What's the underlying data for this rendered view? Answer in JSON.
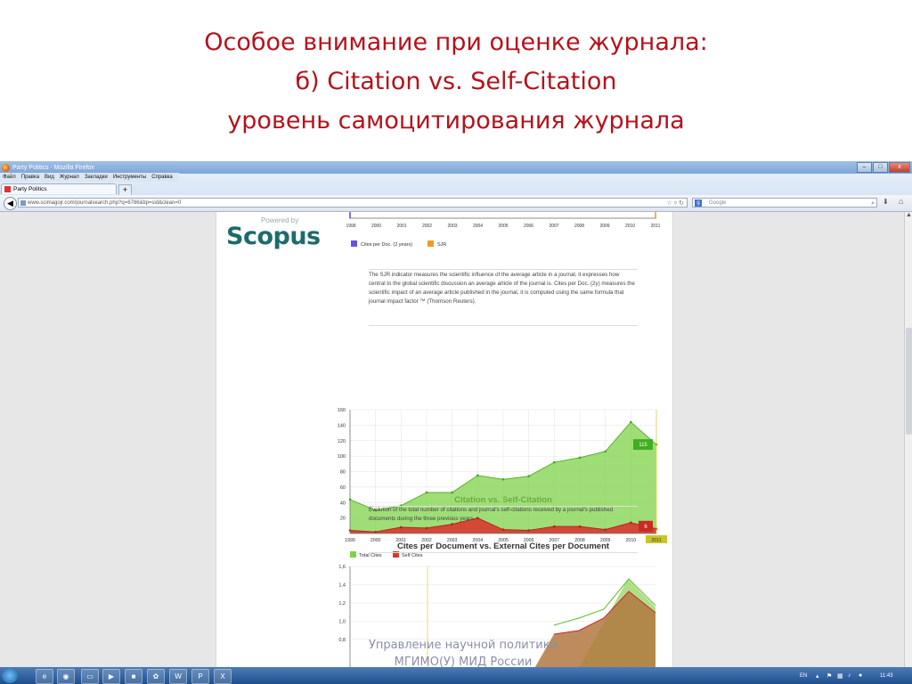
{
  "slide": {
    "title_line1": "Особое внимание при оценке журнала:",
    "title_line2": "б) Citation vs. Self-Citation",
    "title_line3": "уровень самоцитирования журнала",
    "watermark_line1": "Управление научной политики",
    "watermark_line2": "МГИМО(У) МИД России"
  },
  "browser": {
    "window_title": "Party Politics - Mozilla Firefox",
    "menu": [
      "Файл",
      "Правка",
      "Вид",
      "Журнал",
      "Закладки",
      "Инструменты",
      "Справка"
    ],
    "tab_label": "Party Politics",
    "new_tab_label": "+",
    "url": "www.scimagojr.com/journalsearch.php?q=6786&tip=sid&clean=0",
    "url_domain": "scimagojr.com",
    "search_placeholder": "Google",
    "window_controls": [
      "–",
      "□",
      "x"
    ]
  },
  "page": {
    "powered_by": "Powered by",
    "scopus": "Scopus",
    "top_legend": [
      "Cites per Doc. (2 years)",
      "SJR"
    ],
    "top_years": [
      "1999",
      "2000",
      "2001",
      "2002",
      "2003",
      "2004",
      "2005",
      "2006",
      "2007",
      "2008",
      "2009",
      "2010",
      "2011"
    ],
    "description": "The SJR indicator measures the scientific influence of the average article in a journal, it expresses how central to the global scientific discussion an average article of the journal is. Cites per Doc. (2y) measures the scientific impact of an average article published in the journal, it is computed using the same formula that journal impact factor ™ (Thomson Reuters).",
    "chart1_title": "Citation vs. Self-Citation",
    "chart1_description": "Evolution of the total number of citations and journal's self-citations received by a journal's published documents during the three previous years.",
    "chart2_title": "Cites per Document vs. External Cites per Document"
  },
  "chart_data": [
    {
      "type": "area",
      "title": "Citation vs. Self-Citation",
      "x": [
        "1999",
        "2000",
        "2001",
        "2002",
        "2003",
        "2004",
        "2005",
        "2006",
        "2007",
        "2008",
        "2009",
        "2010",
        "2011"
      ],
      "ylim": [
        0,
        160
      ],
      "yticks": [
        20,
        40,
        60,
        80,
        100,
        120,
        140,
        160
      ],
      "series": [
        {
          "name": "Total Cites",
          "color": "#7fd34a",
          "values": [
            44,
            30,
            36,
            53,
            53,
            75,
            70,
            74,
            92,
            98,
            106,
            144,
            115
          ]
        },
        {
          "name": "Self Cites",
          "color": "#d8382f",
          "values": [
            4,
            2,
            8,
            7,
            12,
            20,
            5,
            4,
            9,
            9,
            5,
            14,
            6
          ]
        }
      ],
      "end_labels": [
        "115",
        "6"
      ],
      "highlight_x": "2011"
    },
    {
      "type": "area",
      "title": "Cites per Document vs. External Cites per Document",
      "ylim": [
        0.6,
        1.6
      ],
      "yticks": [
        "0,8",
        "1,0",
        "1,2",
        "1,4",
        "1,6"
      ]
    }
  ],
  "taskbar": {
    "lang": "EN",
    "time": "11:43",
    "apps": [
      "IE",
      "Firefox",
      "Explorer",
      "Media",
      "Word",
      "PowerPoint",
      "Excel"
    ]
  }
}
